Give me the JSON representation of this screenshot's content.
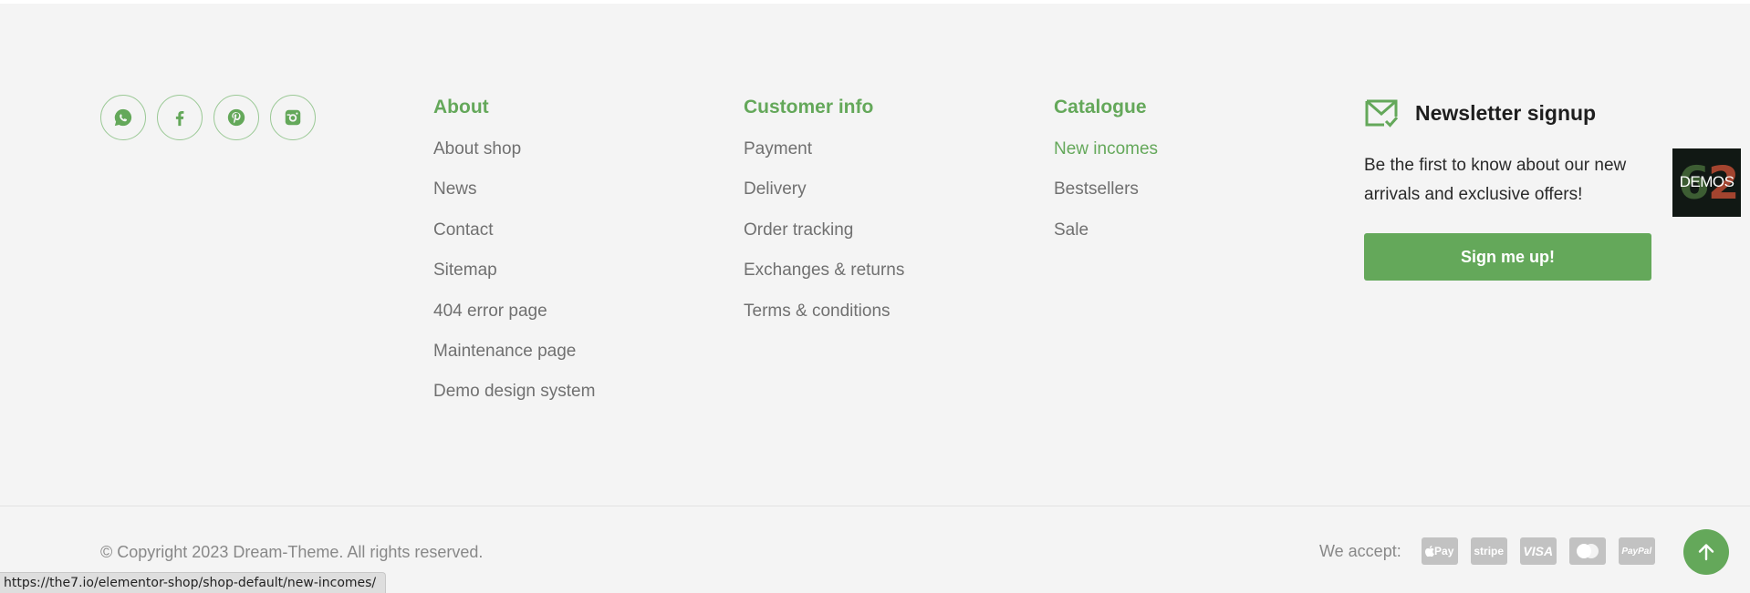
{
  "social": [
    {
      "icon": "whatsapp-icon"
    },
    {
      "icon": "facebook-icon"
    },
    {
      "icon": "pinterest-icon"
    },
    {
      "icon": "instagram-icon"
    }
  ],
  "about": {
    "title": "About",
    "items": [
      "About shop",
      "News",
      "Contact",
      "Sitemap",
      "404 error page",
      "Maintenance page",
      "Demo design system"
    ]
  },
  "customer_info": {
    "title": "Customer info",
    "items": [
      "Payment",
      "Delivery",
      "Order tracking",
      "Exchanges & returns",
      "Terms & conditions"
    ]
  },
  "catalogue": {
    "title": "Catalogue",
    "items": [
      "New incomes",
      "Bestsellers",
      "Sale"
    ],
    "active_index": 0
  },
  "newsletter": {
    "icon": "mail-check-icon",
    "title": "Newsletter signup",
    "text": "Be the first to know about our new arrivals and exclusive offers!",
    "button": "Sign me up!"
  },
  "demos_badge": {
    "number": "62",
    "label": "DEMOS"
  },
  "footer": {
    "copyright": "© Copyright 2023 Dream-Theme. All rights reserved.",
    "accept_label": "We accept:",
    "payments": [
      {
        "name": "Apple Pay",
        "icon": "apple-pay-icon",
        "text": " Pay"
      },
      {
        "name": "Stripe",
        "icon": "stripe-icon",
        "text": "stripe"
      },
      {
        "name": "Visa",
        "icon": "visa-icon",
        "text": "VISA"
      },
      {
        "name": "Mastercard",
        "icon": "mastercard-icon",
        "text": ""
      },
      {
        "name": "PayPal",
        "icon": "paypal-icon",
        "text": "PayPal"
      }
    ]
  },
  "status_bar": {
    "url": "https://the7.io/elementor-shop/shop-default/new-incomes/"
  },
  "colors": {
    "accent": "#64a85a",
    "background": "#f4f4f4",
    "text": "#707070"
  }
}
